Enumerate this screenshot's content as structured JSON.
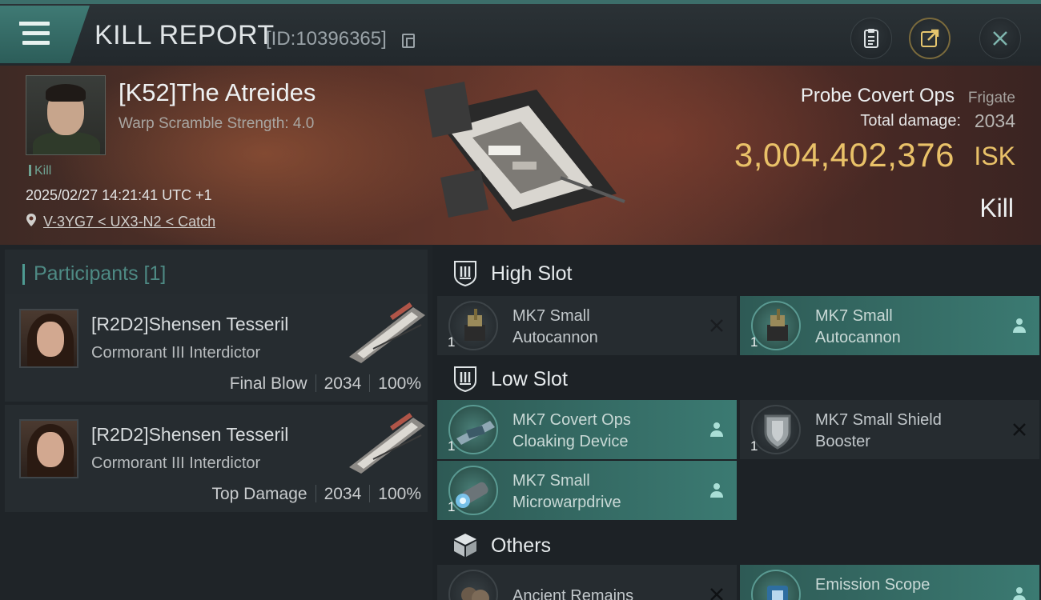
{
  "header": {
    "title": "KILL REPORT",
    "report_id": "[ID:10396365]"
  },
  "victim": {
    "pilot_name": "[K52]The Atreides",
    "warp_scramble": "Warp Scramble Strength: 4.0",
    "tag": "Kill",
    "datetime": "2025/02/27 14:21:41 UTC +1",
    "location": "V-3YG7 < UX3-N2 < Catch",
    "ship_name": "Probe Covert Ops",
    "ship_class": "Frigate",
    "total_damage_label": "Total damage:",
    "total_damage": "2034",
    "isk_value": "3,004,402,376",
    "isk_unit": "ISK",
    "result": "Kill"
  },
  "participants": {
    "title": "Participants [1]",
    "rows": [
      {
        "name": "[R2D2]Shensen Tesseril",
        "ship": "Cormorant III Interdictor",
        "role": "Final Blow",
        "damage": "2034",
        "percent": "100%"
      },
      {
        "name": "[R2D2]Shensen Tesseril",
        "ship": "Cormorant III Interdictor",
        "role": "Top Damage",
        "damage": "2034",
        "percent": "100%"
      }
    ]
  },
  "slots": {
    "high": {
      "label": "High Slot",
      "modules": [
        {
          "qty": "1",
          "line1": "MK7 Small",
          "line2": "Autocannon",
          "status": "destroyed"
        },
        {
          "qty": "1",
          "line1": "MK7 Small",
          "line2": "Autocannon",
          "status": "dropped"
        }
      ]
    },
    "low": {
      "label": "Low Slot",
      "modules": [
        {
          "qty": "1",
          "line1": "MK7 Covert Ops",
          "line2": "Cloaking Device",
          "status": "dropped"
        },
        {
          "qty": "1",
          "line1": "MK7 Small Shield",
          "line2": "Booster",
          "status": "destroyed"
        },
        {
          "qty": "1",
          "line1": "MK7 Small",
          "line2": "Microwarpdrive",
          "status": "dropped"
        }
      ]
    },
    "others": {
      "label": "Others",
      "modules": [
        {
          "qty": "",
          "line1": "Ancient Remains",
          "line2": "",
          "status": "destroyed"
        },
        {
          "qty": "",
          "line1": "Emission Scope",
          "line2": "",
          "status": "dropped"
        }
      ]
    }
  },
  "colors": {
    "accent": "#3f7a74",
    "isk_gold": "#e9c168",
    "fitted_bg": "#3b7a72"
  },
  "icons": {
    "menu": "hamburger-icon",
    "copy": "copy-icon",
    "clipboard": "clipboard-icon",
    "share": "share-icon",
    "close": "close-icon",
    "location": "location-pin-icon",
    "destroyed": "x-mark-icon",
    "dropped": "person-icon"
  }
}
